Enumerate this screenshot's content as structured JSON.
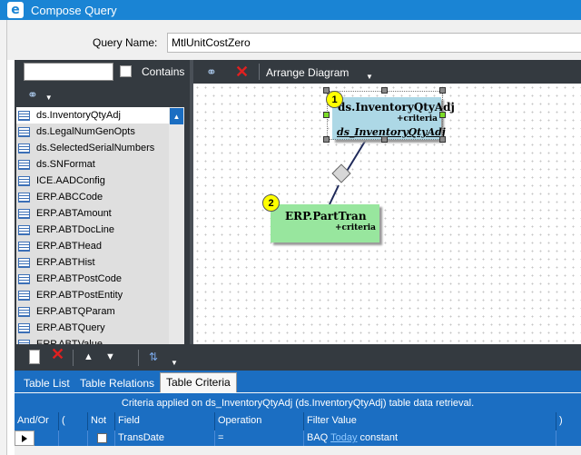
{
  "window": {
    "title": "Compose Query",
    "logo_letter": "e"
  },
  "query": {
    "name_label": "Query Name:",
    "name_value": "MtlUnitCostZero"
  },
  "left_panel": {
    "search_value": "",
    "contains_label": "Contains",
    "tables": [
      "ds.InventoryQtyAdj",
      "ds.LegalNumGenOpts",
      "ds.SelectedSerialNumbers",
      "ds.SNFormat",
      "ICE.AADConfig",
      "ERP.ABCCode",
      "ERP.ABTAmount",
      "ERP.ABTDocLine",
      "ERP.ABTHead",
      "ERP.ABTHist",
      "ERP.ABTPostCode",
      "ERP.ABTPostEntity",
      "ERP.ABTQParam",
      "ERP.ABTQuery",
      "ERP.ABTValue"
    ]
  },
  "diagram": {
    "toolbar": {
      "arrange_label": "Arrange Diagram"
    },
    "nodes": [
      {
        "badge": "1",
        "title": "ds.InventoryQtyAdj",
        "subtitle": "+criteria",
        "alias": "ds_InventoryQtyAdj"
      },
      {
        "badge": "2",
        "title": "ERP.PartTran",
        "subtitle": "+criteria"
      }
    ]
  },
  "bottom": {
    "tabs": [
      "Table List",
      "Table Relations",
      "Table Criteria"
    ],
    "active_tab": "Table Criteria",
    "criteria_header": "Criteria applied on ds_InventoryQtyAdj (ds.InventoryQtyAdj) table data retrieval.",
    "columns": [
      "And/Or",
      "(",
      "Not",
      "Field",
      "Operation",
      "Filter Value",
      ")"
    ],
    "rows": [
      {
        "and_or": "",
        "open_paren": "",
        "not": false,
        "field": "TransDate",
        "operation": "=",
        "filter_prefix": "BAQ",
        "filter_link": "Today",
        "filter_suffix": "constant",
        "close_paren": ""
      }
    ]
  },
  "colors": {
    "accent": "#1b6ec2",
    "titlebar": "#1a84d4",
    "panel": "#343a40",
    "node1": "#add8e6",
    "node2": "#98e69e",
    "badge": "#ffff00"
  }
}
